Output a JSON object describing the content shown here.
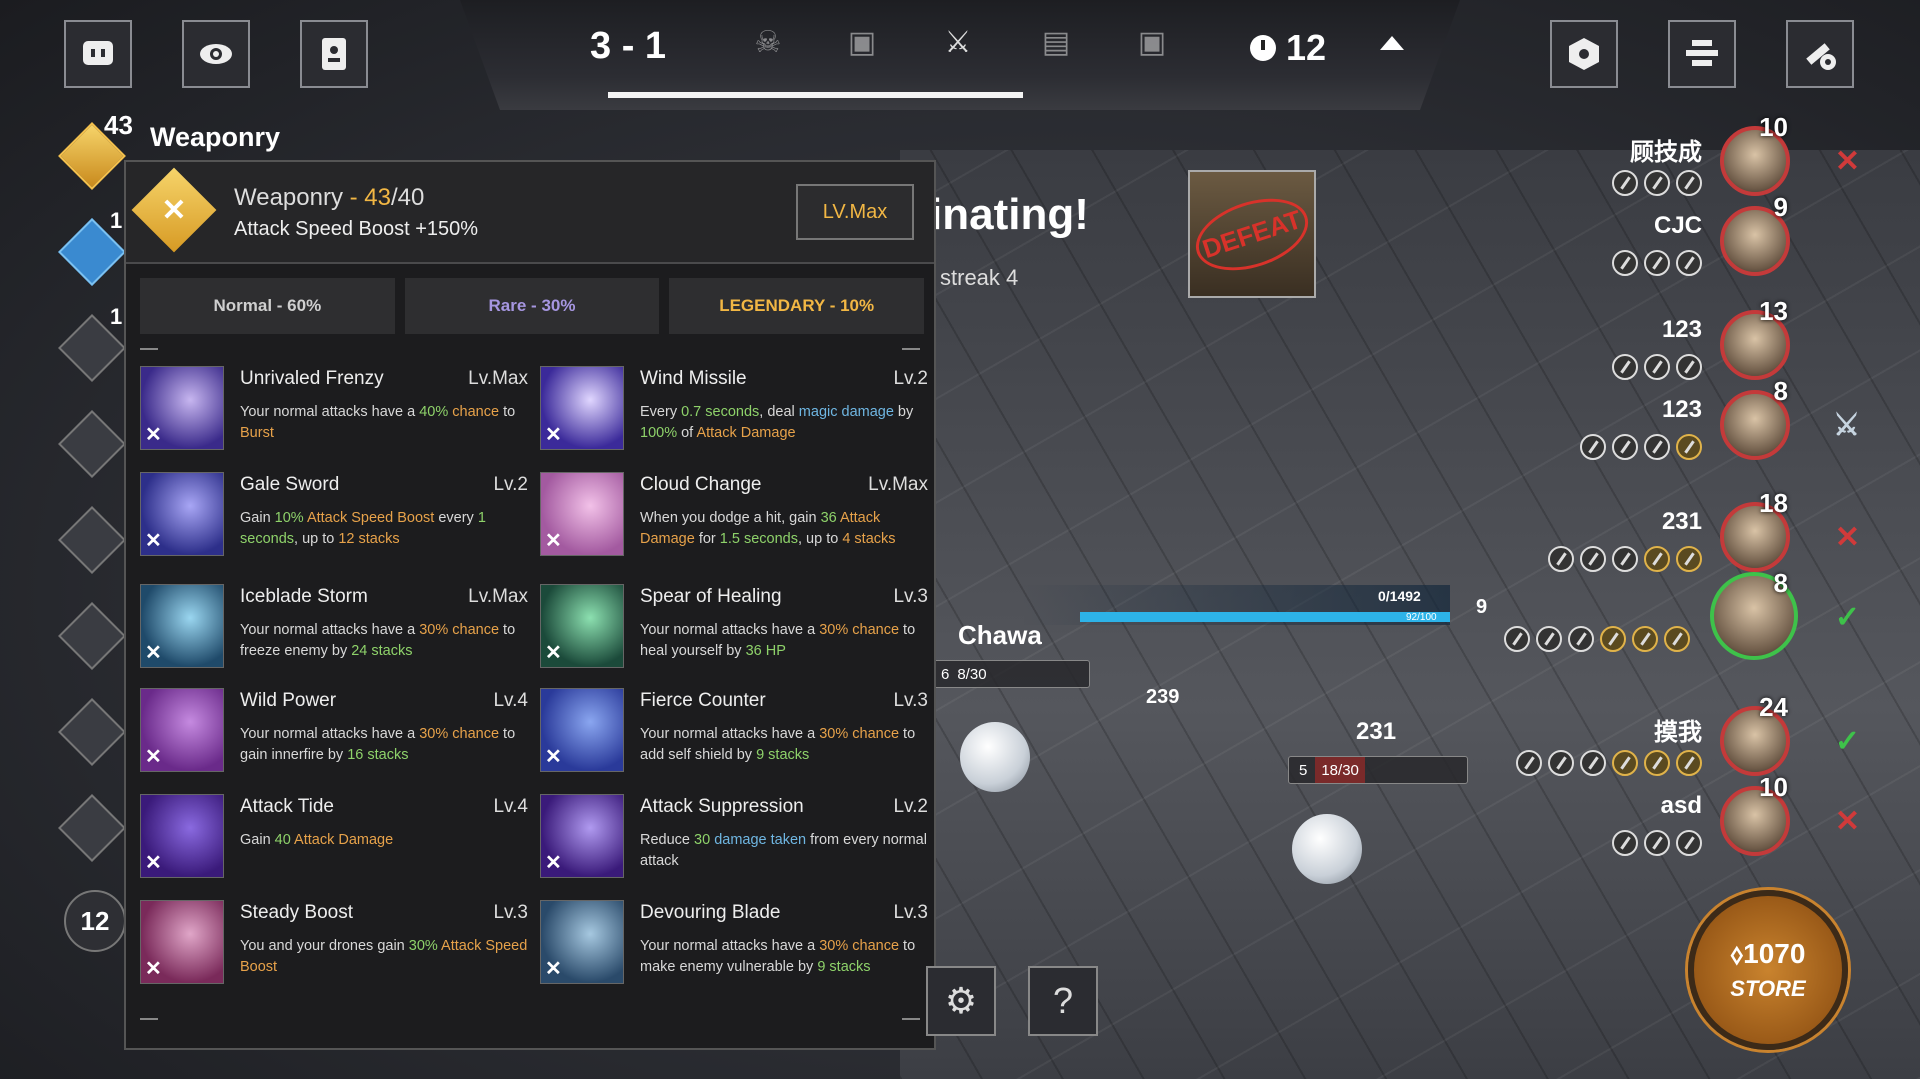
{
  "top": {
    "round": "3 - 1",
    "timer": "12",
    "round_progress": 0.75,
    "buttons": [
      "chat-icon",
      "eye-icon",
      "card-icon",
      "hexagon-icon",
      "stack-icon",
      "tools-icon"
    ],
    "stage_icons": [
      "monster-icon",
      "card-icon",
      "crossed-swords-icon",
      "chest-icon",
      "card-icon"
    ]
  },
  "sidebar": {
    "weaponry_count": "43",
    "weaponry_label": "Weaponry",
    "second_count": "1",
    "third_count": "1",
    "player_level": "12",
    "icons": [
      "weaponry-icon",
      "wing-icon",
      "gear-flower-icon",
      "eagle-icon",
      "shield-icon",
      "flame-icon",
      "lightning-icon",
      "drone-icon"
    ]
  },
  "panel": {
    "title": "Weaponry",
    "dash": "-",
    "current": "43",
    "max": "/40",
    "effect": "Attack Speed Boost +150%",
    "level_badge": "LV.Max",
    "tabs": {
      "normal": "Normal - 60%",
      "rare": "Rare - 30%",
      "legendary": "LEGENDARY - 10%"
    },
    "skills": [
      {
        "name": "Unrivaled Frenzy",
        "level": "Lv.Max",
        "colors": [
          "#3a2a8a",
          "#c7b6f0"
        ]
      },
      {
        "name": "Wind Missile",
        "level": "Lv.2",
        "colors": [
          "#3b2a9a",
          "#e0d6ff"
        ]
      },
      {
        "name": "Gale Sword",
        "level": "Lv.2",
        "colors": [
          "#2d2f8a",
          "#a8a6f5"
        ]
      },
      {
        "name": "Cloud Change",
        "level": "Lv.Max",
        "colors": [
          "#a35aa0",
          "#f2c1e8"
        ]
      },
      {
        "name": "Iceblade Storm",
        "level": "Lv.Max",
        "colors": [
          "#1f4a6a",
          "#9ad6f0"
        ]
      },
      {
        "name": "Spear of Healing",
        "level": "Lv.3",
        "colors": [
          "#1b4a3a",
          "#8ce0b0"
        ]
      },
      {
        "name": "Wild Power",
        "level": "Lv.4",
        "colors": [
          "#6a2a8a",
          "#c58ae0"
        ]
      },
      {
        "name": "Fierce Counter",
        "level": "Lv.3",
        "colors": [
          "#2a3a9a",
          "#8aa6f0"
        ]
      },
      {
        "name": "Attack Tide",
        "level": "Lv.4",
        "colors": [
          "#3a1a7a",
          "#8a6ae0"
        ]
      },
      {
        "name": "Attack Suppression",
        "level": "Lv.2",
        "colors": [
          "#3a1a7a",
          "#b09af0"
        ]
      },
      {
        "name": "Steady Boost",
        "level": "Lv.3",
        "colors": [
          "#7a2a5a",
          "#e0a6c8"
        ]
      },
      {
        "name": "Devouring Blade",
        "level": "Lv.3",
        "colors": [
          "#2a4a6a",
          "#a6c8e0"
        ]
      }
    ],
    "desc": {
      "s0": [
        "Your normal attacks have a ",
        "40%",
        " chance",
        " to ",
        "Burst"
      ],
      "s1": [
        "Every ",
        "0.7 seconds",
        ", deal ",
        "magic damage",
        " by ",
        "100%",
        " of ",
        "Attack Damage"
      ],
      "s2": [
        "Gain ",
        "10%",
        " ",
        "Attack Speed Boost",
        " every ",
        "1 seconds",
        ", up to ",
        "12 stacks"
      ],
      "s3": [
        "When you dodge a hit, gain ",
        "36",
        " ",
        "Attack Damage",
        " for ",
        "1.5 seconds",
        ", up to ",
        "4 stacks"
      ],
      "s4": [
        "Your normal attacks have a ",
        "30% chance",
        " to freeze enemy by ",
        "24 stacks"
      ],
      "s5": [
        "Your normal attacks have a ",
        "30% chance",
        " to heal yourself by ",
        "36 HP"
      ],
      "s6": [
        "Your normal attacks have a ",
        "30% chance",
        " to gain innerfire by ",
        "16 stacks"
      ],
      "s7": [
        "Your normal attacks have a ",
        "30% chance",
        " to add self shield by ",
        "9 stacks"
      ],
      "s8": [
        "Gain ",
        "40",
        " ",
        "Attack Damage"
      ],
      "s9": [
        "Reduce ",
        "30",
        " ",
        "damage taken",
        " from every normal attack"
      ],
      "s10": [
        "You and your drones gain ",
        "30%",
        " ",
        "Attack Speed Boost"
      ],
      "s11": [
        "Your normal attacks have a ",
        "30% chance",
        " to make enemy vulnerable by ",
        "9 stacks"
      ]
    }
  },
  "arena": {
    "banner": "inating!",
    "streak": "streak 4",
    "defeat": "DEFEAT",
    "hp_text": "0/1492",
    "sub_text": "92/100",
    "shield_value": "9",
    "player_name": "Chawa",
    "player_prefix": "6",
    "player_pill": "8/30",
    "enemy_hp": "239",
    "enemy_name": "231",
    "enemy_prefix": "5",
    "enemy_pill": "18/30"
  },
  "players": [
    {
      "name": "顾技成",
      "level": "10",
      "coins": 3,
      "gold": 0,
      "status": "✕",
      "type": "red-x"
    },
    {
      "name": "CJC",
      "level": "9",
      "coins": 3,
      "gold": 0,
      "status": "",
      "type": ""
    },
    {
      "name": "123",
      "level": "13",
      "coins": 3,
      "gold": 0,
      "status": "",
      "type": ""
    },
    {
      "name": "123",
      "level": "8",
      "coins": 3,
      "gold": 1,
      "status": "⚔",
      "type": "sword-x"
    },
    {
      "name": "231",
      "level": "18",
      "coins": 3,
      "gold": 2,
      "status": "✕",
      "type": "red-x"
    },
    {
      "name": "",
      "level": "8",
      "coins": 3,
      "gold": 3,
      "status": "✓",
      "type": "green-check"
    },
    {
      "name": "摸我",
      "level": "24",
      "coins": 3,
      "gold": 3,
      "status": "✓",
      "type": "green-check"
    },
    {
      "name": "asd",
      "level": "10",
      "coins": 3,
      "gold": 0,
      "status": "✕",
      "type": "red-x"
    }
  ],
  "store": {
    "amount": "1070",
    "label": "STORE"
  },
  "bottom": {
    "buttons": [
      "drone-gear-icon",
      "help-icon"
    ]
  }
}
